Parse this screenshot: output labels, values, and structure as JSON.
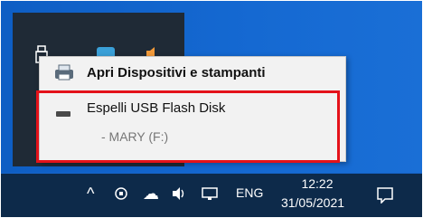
{
  "context_menu": {
    "open_devices_label": "Apri Dispositivi e stampanti",
    "eject_label": "Espelli USB Flash Disk",
    "eject_sublabel": "- MARY (F:)"
  },
  "taskbar": {
    "chevron": "^",
    "language": "ENG",
    "time": "12:22",
    "date": "31/05/2021"
  },
  "colors": {
    "highlight": "#e4121a",
    "desktop": "#1664c8",
    "taskbar": "#0d2a4a"
  }
}
